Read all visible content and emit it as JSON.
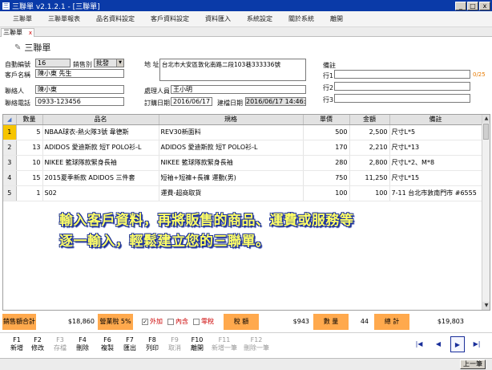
{
  "window": {
    "title": "三聯單 v2.1.2.1 - [三聯單]",
    "controls": [
      "_",
      "□",
      "x"
    ]
  },
  "menu": [
    "三聯單",
    "三聯單報表",
    "品名資料設定",
    "客戶資料設定",
    "資料匯入",
    "系統設定",
    "關於系統",
    "離開"
  ],
  "tab": {
    "label": "三聯單",
    "close": "x"
  },
  "form": {
    "title": "三聯單",
    "auto_no_label": "自動編號",
    "auto_no": "16",
    "sales_label": "銷售別",
    "sales_value": "批發",
    "customer_label": "客戶名稱",
    "customer": "陳小東 先生",
    "contact_label": "聯絡人",
    "contact": "陳小東",
    "phone_label": "聯絡電話",
    "phone": "0933-123456",
    "address_label": "地 址",
    "address": "台北市大安區敦化南路二段103巷333336號",
    "handler_label": "處理人員",
    "handler": "王小明",
    "order_date_label": "訂購日期",
    "order_date": "2016/06/17",
    "created_label": "建檔日期",
    "created": "2016/06/17 14:46:53",
    "note_label": "備註",
    "row1_label": "行1",
    "row2_label": "行2",
    "row3_label": "行3",
    "counter": "0/25"
  },
  "grid": {
    "headers": [
      "數量",
      "品名",
      "規格",
      "單價",
      "金額",
      "備註"
    ],
    "rows": [
      {
        "no": "1",
        "qty": "5",
        "name": "NBAA球衣-熱火隊3號 韋德斯",
        "spec": "REV30新面料",
        "price": "500",
        "amount": "2,500",
        "note": "尺寸L*5"
      },
      {
        "no": "2",
        "qty": "13",
        "name": "ADIDOS 愛迪斯款 短T POLO衫-L",
        "spec": "ADIDOS 愛迪斯款 短T POLO衫-L",
        "price": "170",
        "amount": "2,210",
        "note": "尺寸L*13"
      },
      {
        "no": "3",
        "qty": "10",
        "name": "NIKEE 籃球隊款緊身長袖",
        "spec": "NIKEE 籃球隊款緊身長袖",
        "price": "280",
        "amount": "2,800",
        "note": "尺寸L*2、M*8"
      },
      {
        "no": "4",
        "qty": "15",
        "name": "2015夏季新款 ADIDOS 三件套",
        "spec": "短袖+短褲+長褲 運動(男)",
        "price": "750",
        "amount": "11,250",
        "note": "尺寸L*15"
      },
      {
        "no": "5",
        "qty": "1",
        "name": "S02",
        "spec": "運費-超商取貨",
        "price": "100",
        "amount": "100",
        "note": "7-11 台北市敦南門市 #6555"
      }
    ]
  },
  "overlay": {
    "line1": "輸入客戶資料，再將販售的商品、運費或服務等",
    "line2": "逐一輸入，輕鬆建立您的三聯單。"
  },
  "summary": {
    "sales_total_label": "銷售額合計",
    "sales_total": "$18,860",
    "tax_rate_label": "營業稅 5%",
    "tax_options": [
      "外加",
      "內含",
      "零稅"
    ],
    "tax_label": "稅 額",
    "tax": "$943",
    "qty_label": "數 量",
    "qty": "44",
    "total_label": "總 計",
    "total": "$19,803"
  },
  "fkeys": [
    {
      "key": "F1",
      "label": "新增",
      "enabled": true
    },
    {
      "key": "F2",
      "label": "修改",
      "enabled": true
    },
    {
      "key": "F3",
      "label": "存檔",
      "enabled": false
    },
    {
      "key": "F4",
      "label": "刪除",
      "enabled": true
    },
    {
      "key": "F6",
      "label": "複製",
      "enabled": true
    },
    {
      "key": "F7",
      "label": "匯出",
      "enabled": true
    },
    {
      "key": "F8",
      "label": "列印",
      "enabled": true
    },
    {
      "key": "F9",
      "label": "取消",
      "enabled": false
    },
    {
      "key": "F10",
      "label": "離開",
      "enabled": true
    },
    {
      "key": "F11",
      "label": "新增一筆",
      "enabled": false
    },
    {
      "key": "F12",
      "label": "刪除一筆",
      "enabled": false
    }
  ],
  "nav": [
    "|◀",
    "◀",
    "▶",
    "▶|"
  ],
  "status": {
    "button": "上一筆"
  }
}
